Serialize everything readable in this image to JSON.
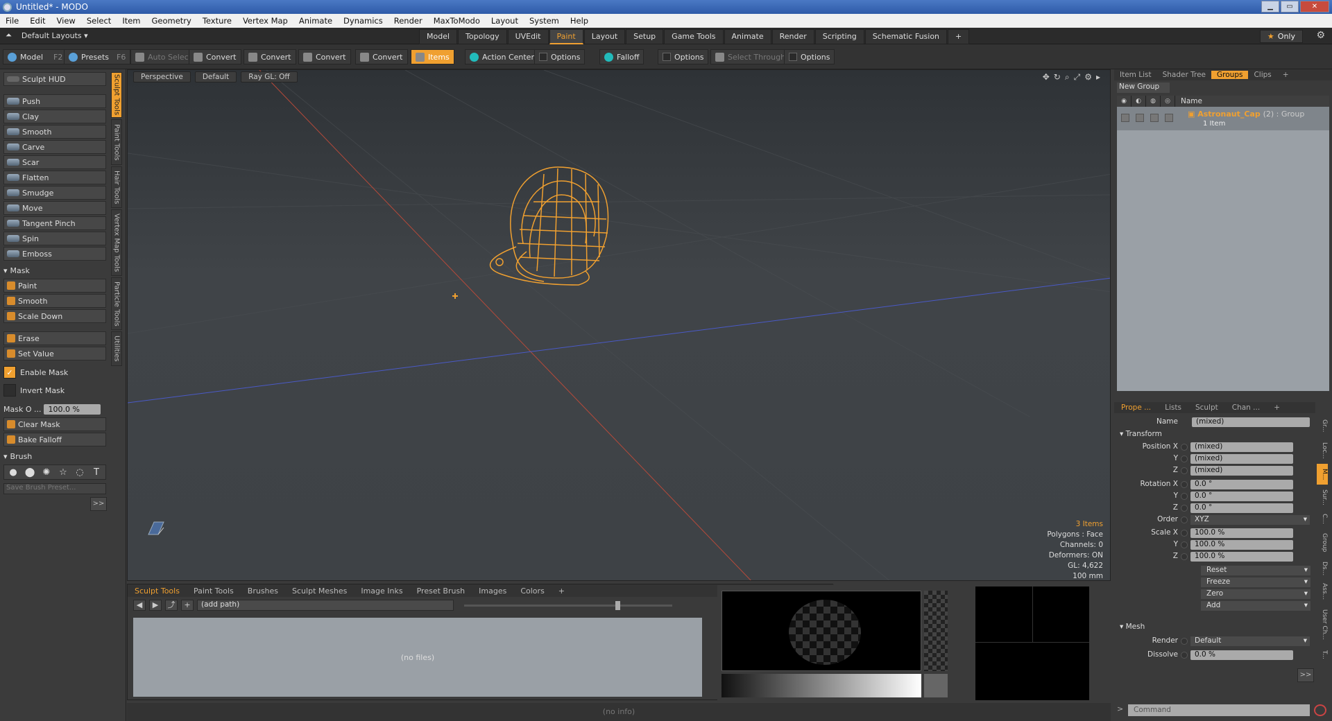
{
  "window": {
    "title": "Untitled* - MODO",
    "buttons": [
      "▁",
      "▭",
      "✕"
    ]
  },
  "menu": [
    "File",
    "Edit",
    "View",
    "Select",
    "Item",
    "Geometry",
    "Texture",
    "Vertex Map",
    "Animate",
    "Dynamics",
    "Render",
    "MaxToModo",
    "Layout",
    "System",
    "Help"
  ],
  "layout_bar": {
    "layout_select": "Default Layouts",
    "tabs": [
      "Model",
      "Topology",
      "UVEdit",
      "Paint",
      "Layout",
      "Setup",
      "Game Tools",
      "Animate",
      "Render",
      "Scripting",
      "Schematic Fusion",
      "+"
    ],
    "active_tab": "Paint",
    "only_label": "Only"
  },
  "toolbar": {
    "model": "Model",
    "model_key": "F2",
    "presets": "Presets",
    "presets_key": "F6",
    "auto_select": "Auto Select",
    "convert": "Convert",
    "items": "Items",
    "action_center": "Action Center",
    "options": "Options",
    "falloff": "Falloff",
    "select_through": "Select Through"
  },
  "sidebar": {
    "sculpt_hud": "Sculpt HUD",
    "tools": [
      "Push",
      "Clay",
      "Smooth",
      "Carve",
      "Scar",
      "Flatten",
      "Smudge",
      "Move",
      "Tangent Pinch",
      "Spin",
      "Emboss"
    ],
    "mask_header": "Mask",
    "mask_tools": [
      "Paint",
      "Smooth",
      "Scale Down"
    ],
    "mask_tools2": [
      "Erase",
      "Set Value"
    ],
    "enable_mask": "Enable Mask",
    "invert_mask": "Invert Mask",
    "mask_opacity_label": "Mask O ...",
    "mask_opacity_value": "100.0 %",
    "mask_actions": [
      "Clear Mask",
      "Bake Falloff"
    ],
    "brush_header": "Brush",
    "save_brush_preset": "Save Brush Preset...",
    "more": ">>"
  },
  "vertical_tabs": [
    "Sculpt Tools",
    "Paint Tools",
    "Hair Tools",
    "Vertex Map Tools",
    "Particle Tools",
    "Utilities"
  ],
  "viewport": {
    "view": "Perspective",
    "shading": "Default",
    "raygl": "Ray GL: Off",
    "info": {
      "items": "3 Items",
      "polygons": "Polygons : Face",
      "channels": "Channels: 0",
      "deformers": "Deformers: ON",
      "gl": "GL: 4,622",
      "scale": "100 mm"
    }
  },
  "bottom": {
    "tabs": [
      "Sculpt Tools",
      "Paint Tools",
      "Brushes",
      "Sculpt Meshes",
      "Image Inks",
      "Preset Brush",
      "Images",
      "Colors",
      "+"
    ],
    "path": "(add path)",
    "files_empty": "(no files)",
    "status": "(no info)"
  },
  "right_panel": {
    "tabs": [
      "Item List",
      "Shader Tree",
      "Groups",
      "Clips",
      "+"
    ],
    "new_group": "New Group",
    "name_header": "Name",
    "group_name": "Astronaut_Cap",
    "group_extra": "(2) : Group",
    "group_sub": "1 Item"
  },
  "properties": {
    "tabs": [
      "Prope ...",
      "Lists",
      "Sculpt",
      "Chan ...",
      "+"
    ],
    "name_label": "Name",
    "name_value": "(mixed)",
    "transform": "Transform",
    "position_label": "Position X",
    "pos": [
      "(mixed)",
      "(mixed)",
      "(mixed)"
    ],
    "rotation_label": "Rotation X",
    "rot": [
      "0.0 °",
      "0.0 °",
      "0.0 °"
    ],
    "order_label": "Order",
    "order": "XYZ",
    "scale_label": "Scale X",
    "scale": [
      "100.0 %",
      "100.0 %",
      "100.0 %"
    ],
    "y": "Y",
    "z": "Z",
    "buttons": [
      "Reset",
      "Freeze",
      "Zero",
      "Add"
    ],
    "mesh": "Mesh",
    "render_label": "Render",
    "render": "Default",
    "dissolve_label": "Dissolve",
    "dissolve": "0.0 %",
    "more": ">>"
  },
  "side_tabs_right": [
    "Gr...",
    "Loc...",
    "M...",
    "Sur...",
    "C...",
    "Group",
    "Ds...",
    "Ass...",
    "User Ch...",
    "T..."
  ],
  "command": "Command"
}
